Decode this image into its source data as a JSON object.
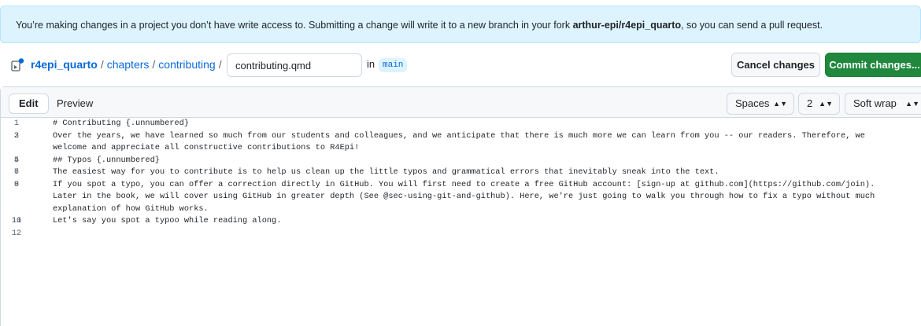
{
  "banner": {
    "text_before": "You’re making changes in a project you don’t have write access to. Submitting a change will write it to a new branch in your fork ",
    "fork_name": "arthur-epi/r4epi_quarto",
    "text_after": ", so you can send a pull request."
  },
  "breadcrumb": {
    "repo": "r4epi_quarto",
    "sep1": "/",
    "folder1": "chapters",
    "sep2": "/",
    "folder2": "contributing",
    "sep3": "/"
  },
  "file": {
    "name": "contributing.qmd",
    "in_label": "in",
    "branch": "main"
  },
  "actions": {
    "cancel_label": "Cancel changes",
    "commit_label": "Commit changes..."
  },
  "editor_toolbar": {
    "edit_tab": "Edit",
    "preview_tab": "Preview",
    "indent_mode": "Spaces",
    "indent_size": "2",
    "wrap_mode": "Soft wrap",
    "caret_icon": "updown-caret-icon"
  },
  "code_lines": [
    {
      "n": "1",
      "text": "# Contributing {.unnumbered}"
    },
    {
      "n": "2",
      "text": ""
    },
    {
      "n": "3",
      "text": "Over the years, we have learned so much from our students and colleagues, and we anticipate that there is much more we can learn from you -- our readers. Therefore, we welcome and appreciate all constructive contributions to R4Epi!"
    },
    {
      "n": "4",
      "text": ""
    },
    {
      "n": "5",
      "text": "## Typos {.unnumbered}"
    },
    {
      "n": "6",
      "text": ""
    },
    {
      "n": "7",
      "text": "The easiest way for you to contribute is to help us clean up the little typos and grammatical errors that inevitably sneak into the text."
    },
    {
      "n": "8",
      "text": ""
    },
    {
      "n": "9",
      "text": "If you spot a typo, you can offer a correction directly in GitHub. You will first need to create a free GitHub account: [sign-up at github.com](https://github.com/join). Later in the book, we will cover using GitHub in greater depth (See @sec-using-git-and-github). Here, we're just going to walk you through how to fix a typo without much explanation of how GitHub works."
    },
    {
      "n": "10",
      "text": ""
    },
    {
      "n": "11",
      "text": "Let's say you spot a typoo while reading along."
    },
    {
      "n": "12",
      "text": ""
    }
  ],
  "colors": {
    "banner_bg": "#ddf4ff",
    "link": "#0969da",
    "commit_green": "#1f883d"
  }
}
